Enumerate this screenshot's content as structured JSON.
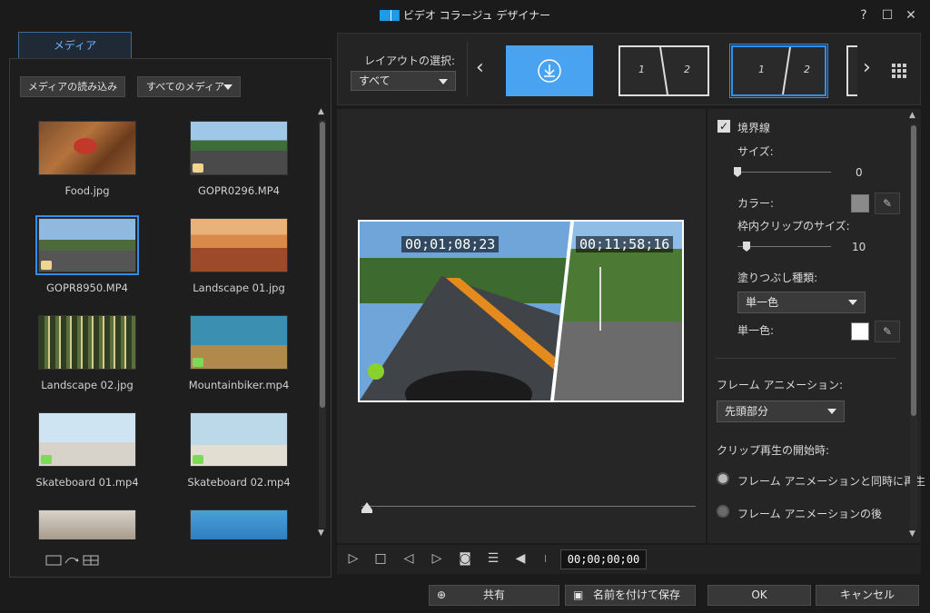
{
  "window": {
    "title": "ビデオ コラージュ デザイナー",
    "help": "?",
    "maximize": "☐",
    "close": "✕"
  },
  "media": {
    "tab": "メディア",
    "import_button": "メディアの読み込み",
    "filter_value": "すべてのメディア",
    "items": [
      {
        "name": "Food.jpg",
        "kind": "image"
      },
      {
        "name": "GOPR0296.MP4",
        "kind": "video"
      },
      {
        "name": "GOPR8950.MP4",
        "kind": "video",
        "selected": true
      },
      {
        "name": "Landscape 01.jpg",
        "kind": "image"
      },
      {
        "name": "Landscape 02.jpg",
        "kind": "image"
      },
      {
        "name": "Mountainbiker.mp4",
        "kind": "video"
      },
      {
        "name": "Skateboard 01.mp4",
        "kind": "video"
      },
      {
        "name": "Skateboard 02.mp4",
        "kind": "video"
      }
    ]
  },
  "layout": {
    "label": "レイアウトの選択:",
    "filter_value": "すべて",
    "slot1": "1",
    "slot2": "2"
  },
  "preview": {
    "timecode_left": "00;01;08;23",
    "timecode_right": "00;11;58;16",
    "player_time": "00;00;00;00"
  },
  "props": {
    "border_label": "境界線",
    "size_label": "サイズ:",
    "size_value": "0",
    "color_label": "カラー:",
    "inner_size_label": "枠内クリップのサイズ:",
    "inner_size_value": "10",
    "fill_type_label": "塗りつぶし種類:",
    "fill_type_value": "単一色",
    "single_color_label": "単一色:",
    "frame_anim_label": "フレーム アニメーション:",
    "frame_anim_value": "先頭部分",
    "clip_start_label": "クリップ再生の開始時:",
    "radio1": "フレーム アニメーションと同時に再生",
    "radio2": "フレーム アニメーションの後",
    "border_color": "#8a8a8a",
    "fill_color": "#ffffff"
  },
  "footer": {
    "share": "共有",
    "save_as": "名前を付けて保存",
    "ok": "OK",
    "cancel": "キャンセル"
  },
  "colors": {
    "accent": "#2f8ff0",
    "download_tile": "#4aa3f0"
  }
}
